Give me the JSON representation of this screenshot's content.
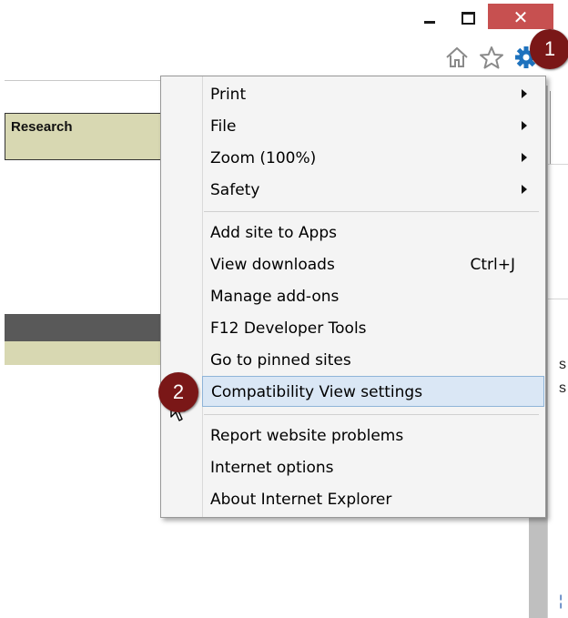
{
  "window": {
    "close_label": "✕"
  },
  "command_bar": {
    "icons": [
      "home-icon",
      "star-icon",
      "gear-icon"
    ]
  },
  "page": {
    "research_label": "Research",
    "right_fragments": [
      "s",
      "s",
      "¦"
    ]
  },
  "menu": {
    "groups": [
      [
        {
          "label": "Print",
          "submenu": true
        },
        {
          "label": "File",
          "submenu": true
        },
        {
          "label": "Zoom (100%)",
          "submenu": true
        },
        {
          "label": "Safety",
          "submenu": true
        }
      ],
      [
        {
          "label": "Add site to Apps"
        },
        {
          "label": "View downloads",
          "shortcut": "Ctrl+J"
        },
        {
          "label": "Manage add-ons"
        },
        {
          "label": "F12 Developer Tools"
        },
        {
          "label": "Go to pinned sites"
        },
        {
          "label": "Compatibility View settings",
          "highlighted": true
        }
      ],
      [
        {
          "label": "Report website problems"
        },
        {
          "label": "Internet options"
        },
        {
          "label": "About Internet Explorer"
        }
      ]
    ]
  },
  "callouts": {
    "step_1": "1",
    "step_2": "2"
  },
  "colors": {
    "close_button": "#c75050",
    "callout_badge": "#7a1717",
    "highlight": "#dae7f5",
    "research_bg": "#d8d8b2",
    "gear_blue": "#1e72bd"
  }
}
